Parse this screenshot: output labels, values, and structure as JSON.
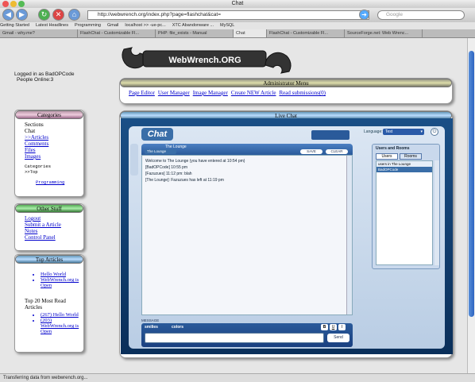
{
  "window": {
    "title": "Chat"
  },
  "toolbar": {
    "url": "http://webwrench.org/index.php?page=flashchat&cat=",
    "search_placeholder": "Google"
  },
  "bookmarks": [
    "Getting Started",
    "Latest Headlines",
    "Programming",
    "Gmail",
    "localhost >> -ue-pc...",
    "XTC Abandonware ...",
    "MySQL"
  ],
  "tabs": [
    "Gmail - why.me?",
    "FlashChat - Customizable Fl...",
    "PHP: file_exists - Manual",
    "Chat",
    "FlashChat - Customizable Fl...",
    "SourceForge.net: Web Wrenc..."
  ],
  "active_tab": 3,
  "status": "Transferring data from webwrench.org...",
  "logo": {
    "text": "WebWrench.ORG"
  },
  "login": {
    "line1": "Logged in as BadOPCode",
    "line2": "People Online:3"
  },
  "admin": {
    "title": "Administrator Menu",
    "links": [
      "Page Editor",
      "User Manager",
      "Image Manager",
      "Create NEW Article",
      "Read submissions(0)"
    ]
  },
  "categories": {
    "title": "Categories",
    "sections_label": "Sections",
    "items": [
      "Chat",
      ">>Articles",
      "Comments",
      "Files",
      "Images"
    ],
    "sub_label": "Categories",
    "sub_top": ">>Top",
    "sub_item": "Programming"
  },
  "other": {
    "title": "Other Stuff",
    "items": [
      "Logout",
      "Submit a Article",
      "Notes",
      "Control Panel"
    ]
  },
  "top_articles": {
    "title": "Top Articles",
    "items": [
      "Hello World",
      "WebWrench.org is Open"
    ],
    "top20_label": "Top 20 Most Read Articles",
    "top20": [
      "(267) Hello World",
      "(203) WebWrench.org is Open"
    ]
  },
  "livechat": {
    "title": "Live Chat",
    "room": "The Lounge",
    "lang_label": "Language:",
    "lang_value": "Test",
    "save_label": "SAVE",
    "clear_label": "CLEAR",
    "messages": [
      "Welcome to The Lounge (you have entered at 10:54 pm)",
      "[BadOPCode] 10:55 pm",
      "[Fazuzues] 11:12 pm: blah",
      "[The Lounge]: Fazuzues has left at 11:19 pm"
    ],
    "users_title": "Users and Rooms",
    "users_tab": "Users",
    "rooms_tab": "Rooms",
    "users": [
      "users in The Lounge",
      "BadOPCode"
    ],
    "message_label": "MESSAGE",
    "smilies_label": "smilies",
    "colors_label": "colors",
    "bold": "B",
    "underline": "U",
    "italic": "I",
    "send_label": "Send"
  }
}
